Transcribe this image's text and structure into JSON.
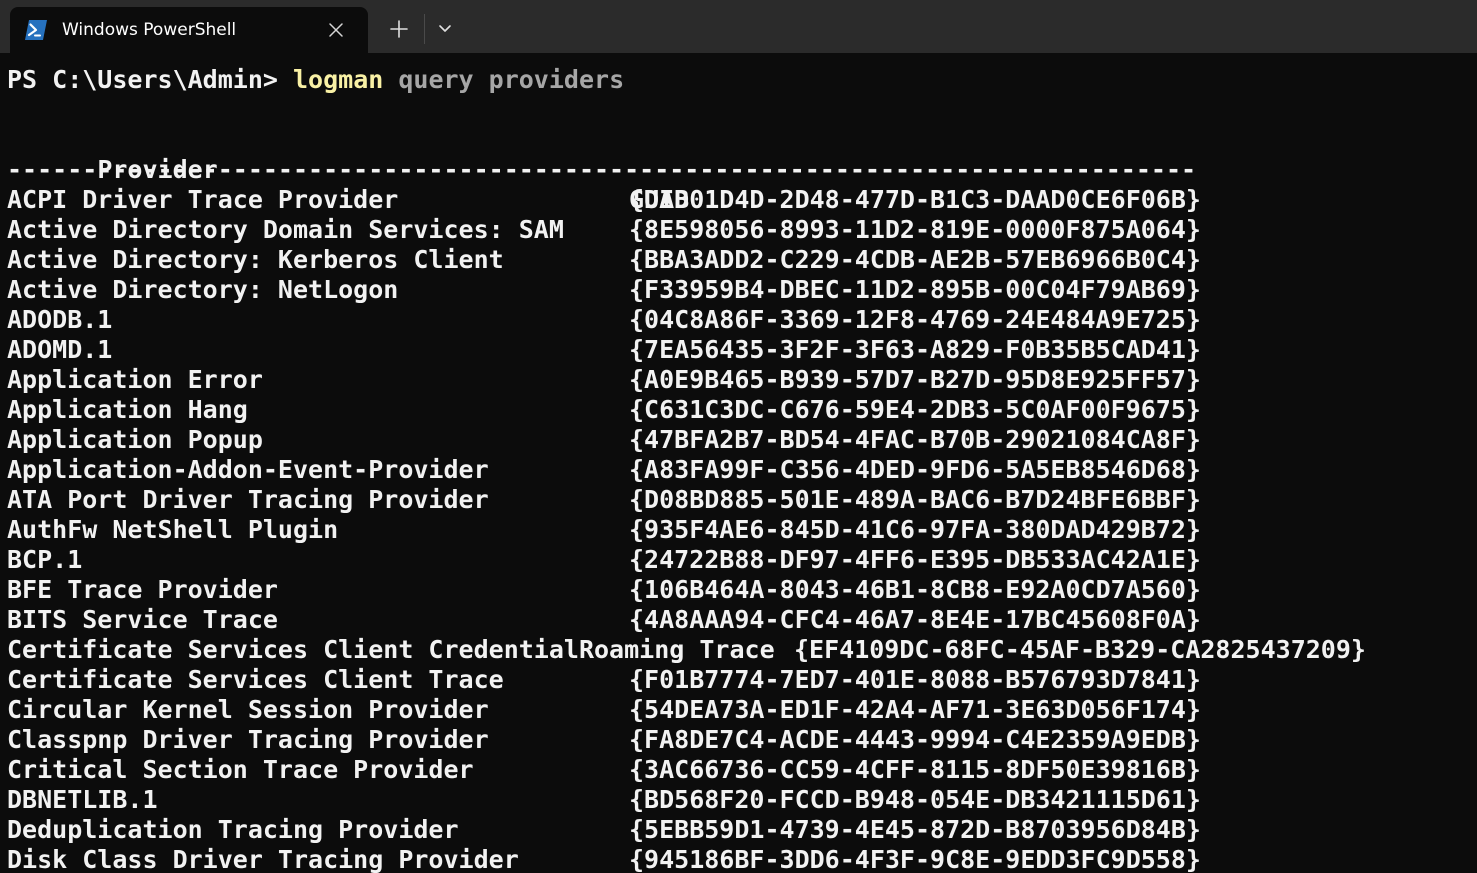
{
  "tab": {
    "title": "Windows PowerShell",
    "icon": "powershell-icon"
  },
  "buttons": {
    "close_icon": "close-icon",
    "new_tab_icon": "plus-icon",
    "dropdown_icon": "chevron-down-icon"
  },
  "colors": {
    "background": "#0c0c0c",
    "tabbar": "#2b2b2b",
    "text": "#f2f2f2",
    "command": "#f9f1a5",
    "argument": "#a6a6a6",
    "powershell_icon": "#2671be"
  },
  "prompt": {
    "text": "PS C:\\Users\\Admin> ",
    "command": "logman",
    "args": " query providers"
  },
  "table": {
    "header_provider": "Provider",
    "header_guid": "GUID",
    "separator": "-------------------------------------------------------------------------------",
    "rows": [
      {
        "provider": "ACPI Driver Trace Provider",
        "guid": "{DAB01D4D-2D48-477D-B1C3-DAAD0CE6F06B}"
      },
      {
        "provider": "Active Directory Domain Services: SAM",
        "guid": "{8E598056-8993-11D2-819E-0000F875A064}"
      },
      {
        "provider": "Active Directory: Kerberos Client",
        "guid": "{BBA3ADD2-C229-4CDB-AE2B-57EB6966B0C4}"
      },
      {
        "provider": "Active Directory: NetLogon",
        "guid": "{F33959B4-DBEC-11D2-895B-00C04F79AB69}"
      },
      {
        "provider": "ADODB.1",
        "guid": "{04C8A86F-3369-12F8-4769-24E484A9E725}"
      },
      {
        "provider": "ADOMD.1",
        "guid": "{7EA56435-3F2F-3F63-A829-F0B35B5CAD41}"
      },
      {
        "provider": "Application Error",
        "guid": "{A0E9B465-B939-57D7-B27D-95D8E925FF57}"
      },
      {
        "provider": "Application Hang",
        "guid": "{C631C3DC-C676-59E4-2DB3-5C0AF00F9675}"
      },
      {
        "provider": "Application Popup",
        "guid": "{47BFA2B7-BD54-4FAC-B70B-29021084CA8F}"
      },
      {
        "provider": "Application-Addon-Event-Provider",
        "guid": "{A83FA99F-C356-4DED-9FD6-5A5EB8546D68}"
      },
      {
        "provider": "ATA Port Driver Tracing Provider",
        "guid": "{D08BD885-501E-489A-BAC6-B7D24BFE6BBF}"
      },
      {
        "provider": "AuthFw NetShell Plugin",
        "guid": "{935F4AE6-845D-41C6-97FA-380DAD429B72}"
      },
      {
        "provider": "BCP.1",
        "guid": "{24722B88-DF97-4FF6-E395-DB533AC42A1E}"
      },
      {
        "provider": "BFE Trace Provider",
        "guid": "{106B464A-8043-46B1-8CB8-E92A0CD7A560}"
      },
      {
        "provider": "BITS Service Trace",
        "guid": "{4A8AAA94-CFC4-46A7-8E4E-17BC45608F0A}"
      },
      {
        "provider": "Certificate Services Client CredentialRoaming Trace",
        "guid": "{EF4109DC-68FC-45AF-B329-CA2825437209}",
        "wide": true
      },
      {
        "provider": "Certificate Services Client Trace",
        "guid": "{F01B7774-7ED7-401E-8088-B576793D7841}"
      },
      {
        "provider": "Circular Kernel Session Provider",
        "guid": "{54DEA73A-ED1F-42A4-AF71-3E63D056F174}"
      },
      {
        "provider": "Classpnp Driver Tracing Provider",
        "guid": "{FA8DE7C4-ACDE-4443-9994-C4E2359A9EDB}"
      },
      {
        "provider": "Critical Section Trace Provider",
        "guid": "{3AC66736-CC59-4CFF-8115-8DF50E39816B}"
      },
      {
        "provider": "DBNETLIB.1",
        "guid": "{BD568F20-FCCD-B948-054E-DB3421115D61}"
      },
      {
        "provider": "Deduplication Tracing Provider",
        "guid": "{5EBB59D1-4739-4E45-872D-B8703956D84B}"
      },
      {
        "provider": "Disk Class Driver Tracing Provider",
        "guid": "{945186BF-3DD6-4F3F-9C8E-9EDD3FC9D558}"
      }
    ]
  }
}
